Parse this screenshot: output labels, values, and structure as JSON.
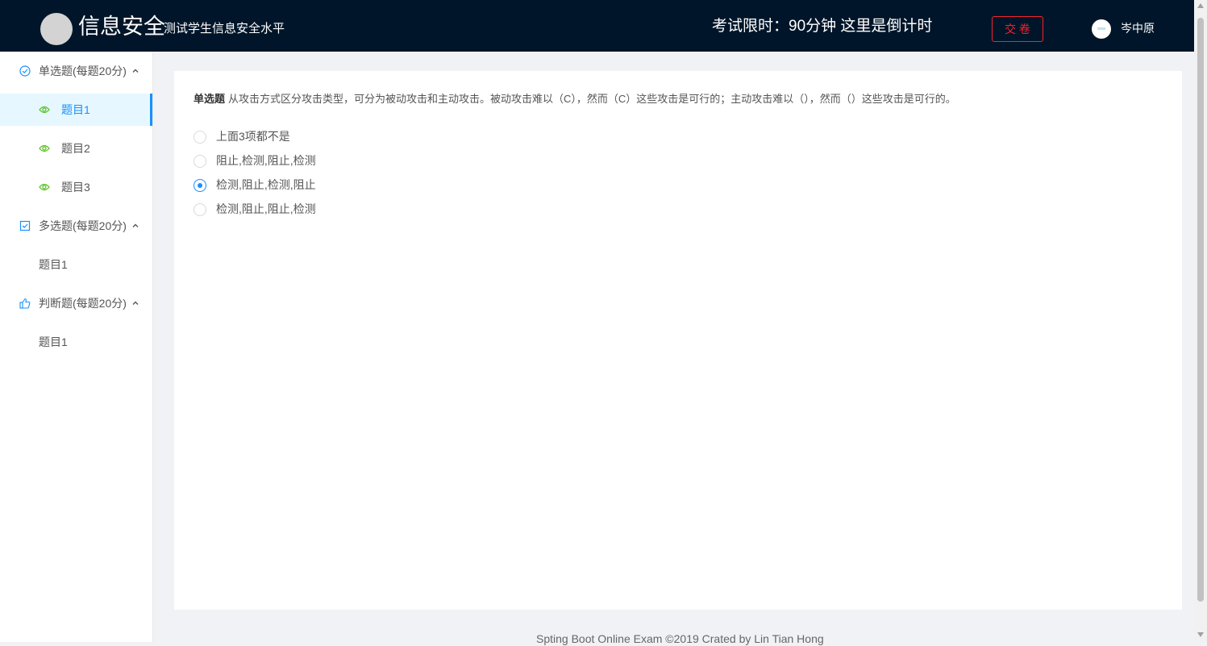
{
  "header": {
    "title": "信息安全",
    "subtitle": "测试学生信息安全水平",
    "timer": "考试限时：90分钟 这里是倒计时",
    "submit_label": "交 卷",
    "username": "岑中原"
  },
  "sidebar": {
    "groups": [
      {
        "label": "单选题(每题20分)",
        "icon": "check-circle-icon",
        "items": [
          "题目1",
          "题目2",
          "题目3"
        ]
      },
      {
        "label": "多选题(每题20分)",
        "icon": "checkbox-icon",
        "items": [
          "题目1"
        ]
      },
      {
        "label": "判断题(每题20分)",
        "icon": "thumbs-up-icon",
        "items": [
          "题目1"
        ]
      }
    ],
    "active_item": "题目1"
  },
  "question": {
    "type_label": "单选题",
    "text": "从攻击方式区分攻击类型，可分为被动攻击和主动攻击。被动攻击难以（C），然而（C）这些攻击是可行的；主动攻击难以（），然而（）这些攻击是可行的。",
    "options": [
      "上面3项都不是",
      "阻止,检测,阻止,检测",
      "检测,阻止,检测,阻止",
      "检测,阻止,阻止,检测"
    ],
    "selected_option": "检测,阻止,检测,阻止"
  },
  "footer": {
    "text": "Spting Boot Online Exam ©2019 Crated by Lin Tian Hong"
  },
  "colors": {
    "header_bg": "#001529",
    "accent": "#1890ff",
    "danger": "#f5222d",
    "eye_icon": "#52c41a"
  }
}
